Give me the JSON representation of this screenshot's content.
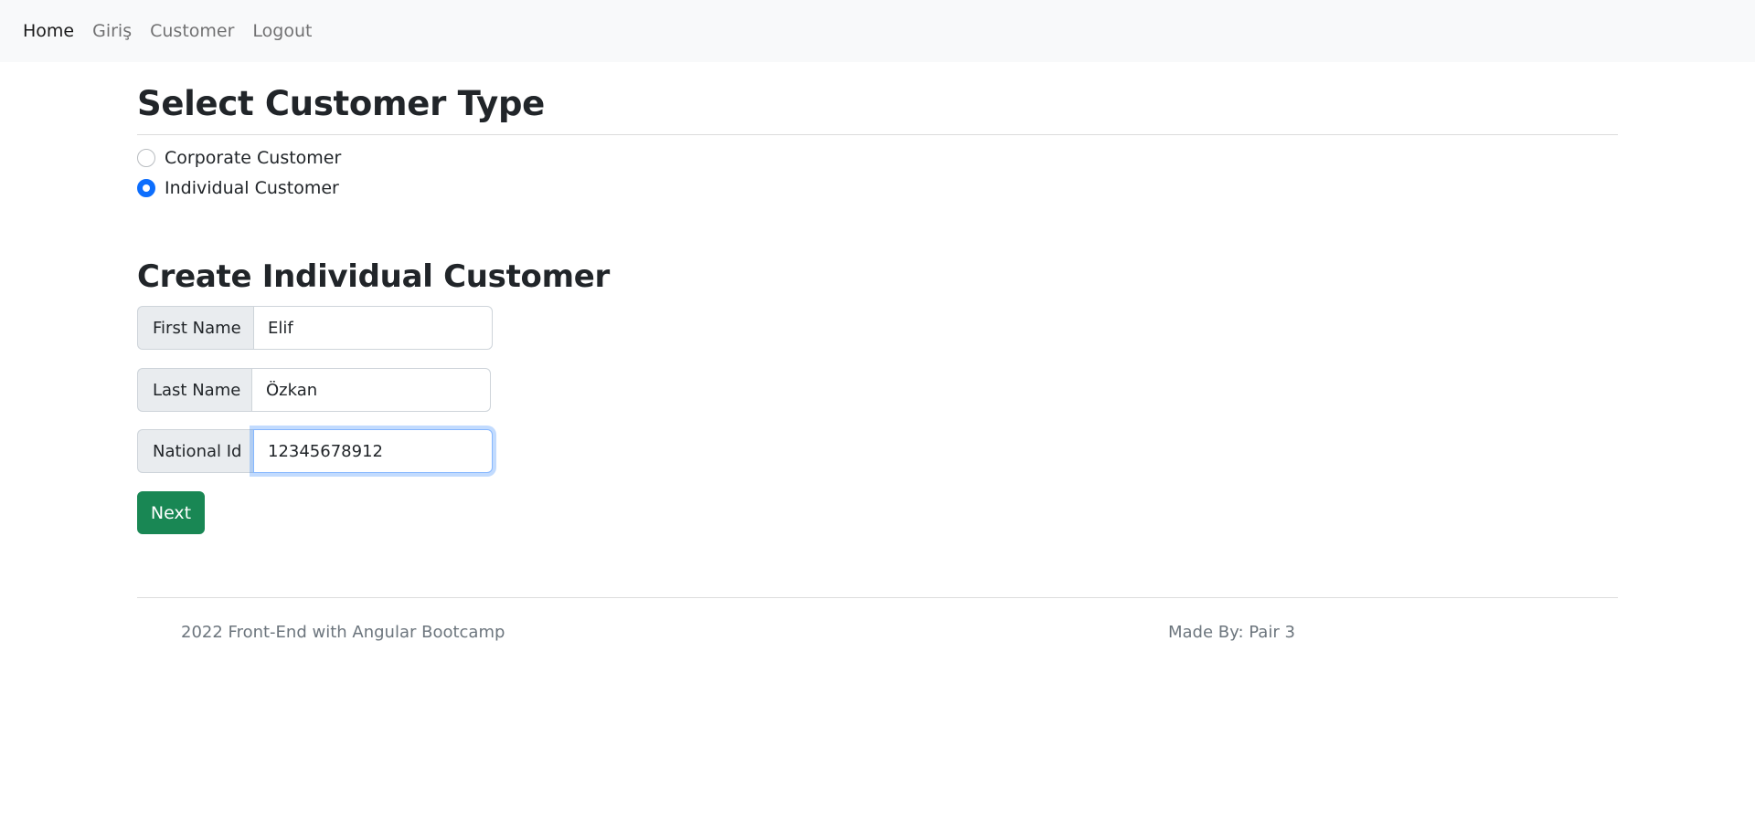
{
  "navbar": {
    "links": [
      {
        "label": "Home",
        "active": true
      },
      {
        "label": "Giriş",
        "active": false
      },
      {
        "label": "Customer",
        "active": false
      },
      {
        "label": "Logout",
        "active": false
      }
    ]
  },
  "customer_type": {
    "title": "Select Customer Type",
    "options": [
      {
        "label": "Corporate Customer",
        "checked": false
      },
      {
        "label": "Individual Customer",
        "checked": true
      }
    ]
  },
  "form": {
    "title": "Create Individual Customer",
    "fields": [
      {
        "label": "First Name",
        "value": "Elif"
      },
      {
        "label": "Last Name",
        "value": "Özkan"
      },
      {
        "label": "National Id",
        "value": "12345678912"
      }
    ],
    "submit_label": "Next"
  },
  "footer": {
    "left_text": "2022 Front-End with Angular Bootcamp",
    "right_text": "Made By: Pair 3"
  },
  "colors": {
    "navbar_bg": "#f8f9fa",
    "primary": "#0d6efd",
    "success": "#198754",
    "muted": "#6c757d"
  }
}
